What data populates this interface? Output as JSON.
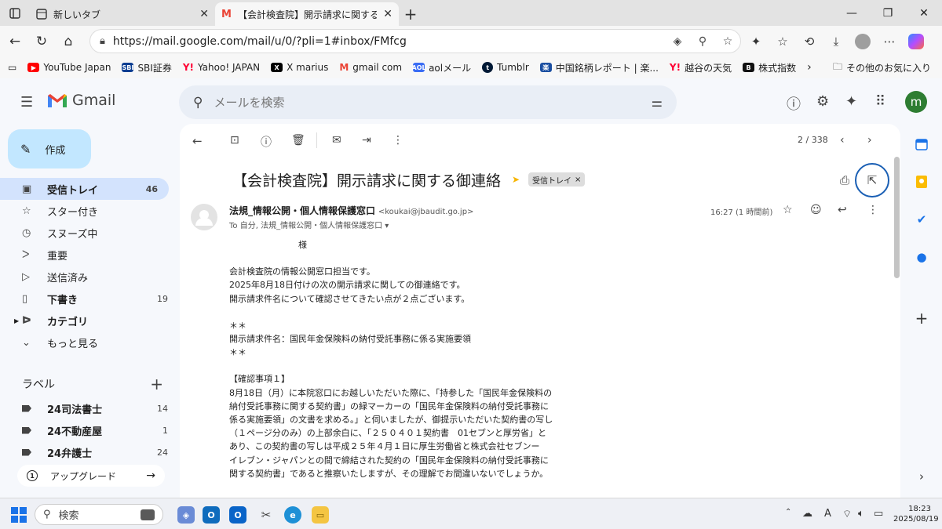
{
  "browser": {
    "tabs": [
      {
        "title": "新しいタブ"
      },
      {
        "title": "【会計検査院】開示請求に関する御連"
      }
    ],
    "url": "https://mail.google.com/mail/u/0/?pli=1#inbox/FMfcg",
    "bookmarks": [
      {
        "label": "YouTube Japan",
        "icon": "youtube-icon",
        "color": "#ff0000"
      },
      {
        "label": "SBI証券",
        "icon": "sbi-icon",
        "color": "#0a3d91"
      },
      {
        "label": "Yahoo! JAPAN",
        "icon": "yahoo-icon",
        "color": "#ff0033"
      },
      {
        "label": "X marius",
        "icon": "x-icon",
        "color": "#000000"
      },
      {
        "label": "gmail com",
        "icon": "gmail-icon",
        "color": "#ea4335"
      },
      {
        "label": "aolメール",
        "icon": "aol-icon",
        "color": "#3a6cf4"
      },
      {
        "label": "Tumblr",
        "icon": "tumblr-icon",
        "color": "#001935"
      },
      {
        "label": "中国銘柄レポート | 楽...",
        "icon": "rakuten-icon",
        "color": "#1a4ea1"
      },
      {
        "label": "越谷の天気",
        "icon": "yahoo-icon",
        "color": "#ff0033"
      },
      {
        "label": "株式指数",
        "icon": "b-icon",
        "color": "#111111"
      }
    ],
    "other_favorites": "その他のお気に入り"
  },
  "gmail": {
    "brand": "Gmail",
    "search_placeholder": "メールを検索",
    "compose_label": "作成",
    "avatar_letter": "m",
    "nav": [
      {
        "label": "受信トレイ",
        "count": "46",
        "icon": "inbox-icon"
      },
      {
        "label": "スター付き",
        "count": "",
        "icon": "star-icon"
      },
      {
        "label": "スヌーズ中",
        "count": "",
        "icon": "clock-icon"
      },
      {
        "label": "重要",
        "count": "",
        "icon": "important-icon"
      },
      {
        "label": "送信済み",
        "count": "",
        "icon": "send-icon"
      },
      {
        "label": "下書き",
        "count": "19",
        "icon": "draft-icon"
      },
      {
        "label": "カテゴリ",
        "count": "",
        "icon": "label-icon"
      },
      {
        "label": "もっと見る",
        "count": "",
        "icon": "chevron-down-icon"
      }
    ],
    "labels_title": "ラベル",
    "labels": [
      {
        "label": "24司法書士",
        "count": "14"
      },
      {
        "label": "24不動産屋",
        "count": "1"
      },
      {
        "label": "24弁護士",
        "count": "24"
      }
    ],
    "upgrade_label": "アップグレード",
    "pager": "2 / 338",
    "email": {
      "subject": "【会計検査院】開示請求に関する御連絡",
      "chip": "受信トレイ",
      "sender_name": "法規_情報公開・個人情報保護窓口",
      "sender_addr": "<koukai@jbaudit.go.jp>",
      "recipients": "To 自分, 法規_情報公開・個人情報保護窓口",
      "time": "16:27 (1 時間前)",
      "body_lines": [
        "　　　　　　　　様",
        "",
        "会計検査院の情報公開窓口担当です。",
        "2025年8月18日付けの次の開示請求に関しての御連絡です。",
        "開示請求件名について確認させてきたい点が２点ございます。",
        "",
        "＊＊",
        "開示請求件名：国民年金保険料の納付受託事務に係る実施要領",
        "＊＊",
        "",
        "【確認事項１】",
        "8月18日（月）に本院窓口にお越しいただいた際に、「持参した「国民年金保険料の",
        "納付受託事務に関する契約書」の緑マーカーの「国民年金保険料の納付受託事務に",
        "係る実施要領」の文書を求める。」と伺いましたが、御提示いただいた契約書の写し",
        "（１ページ分のみ）の上部余白に、「２５０４０１契約書　01セブンと厚労省」と",
        "あり、この契約書の写しは平成２５年４月１日に厚生労働省と株式会社セブンー",
        "イレブン・ジャパンとの間で締結された契約の「国民年金保険料の納付受託事務に",
        "関する契約書」であると推察いたしますが、その理解でお間違いないでしょうか。"
      ]
    }
  },
  "taskbar": {
    "search_placeholder": "検索",
    "time": "18:23",
    "date": "2025/08/19",
    "ime": "A"
  }
}
